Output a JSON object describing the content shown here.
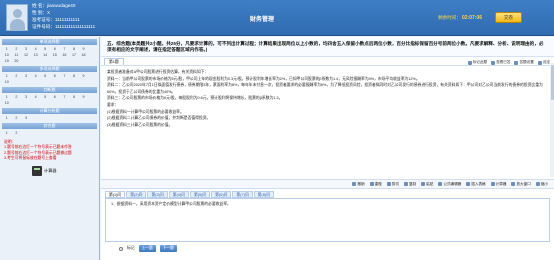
{
  "header": {
    "candidate_name_line": "姓 名：jiaowudage40",
    "candidate_gender_line": "性 别：X",
    "candidate_id_line": "准考证号：11111111111",
    "candidate_idcard_line": "证件号码：111111111111111111",
    "title": "财务管理",
    "timer_label": "剩余时间：",
    "timer_value": "02:07:06",
    "submit_label": "交卷"
  },
  "sidebar": {
    "sections": [
      {
        "title": "单项选择题",
        "numbers": [
          "1",
          "2",
          "3",
          "4",
          "5",
          "6",
          "7",
          "8",
          "9",
          "10",
          "11",
          "12",
          "13",
          "14",
          "15",
          "16",
          "17",
          "18",
          "19",
          "20"
        ]
      },
      {
        "title": "多项选择题",
        "numbers": [
          "1",
          "2",
          "3",
          "4",
          "5",
          "6",
          "7",
          "8",
          "9",
          "10"
        ]
      },
      {
        "title": "判断题",
        "numbers": [
          "1",
          "2",
          "3",
          "4",
          "5",
          "6",
          "7",
          "8",
          "9",
          "10"
        ]
      },
      {
        "title": "计算分析题",
        "numbers": [
          "1",
          "2",
          "3"
        ]
      },
      {
        "title": "综合题",
        "numbers": [
          "1",
          "2"
        ]
      }
    ],
    "notes": [
      "说明：",
      "1.题号前右边打一个符号表示已题未作答",
      "2.题号前右边打一个符号表示已题做过题",
      "3.考生可将鼠标放在题号上查看"
    ],
    "calculator_label": "计算器"
  },
  "main": {
    "question_title": "五、综合题(本类题共2小题，共25分，凡要求计算的，可不列出计算过程；计算结果出现两位以上小数的，均四舍五入保留小数点后两位小数，百分比指标保留百分号前两位小数。凡要求解释、分析、说明理由的，必须有相应的文字阐述，请在指定答题区域内作答。)",
    "question_tabs": [
      "第1题"
    ],
    "toolbar": [
      "标记此题",
      "查看已答",
      "答题设置",
      "设定"
    ],
    "body_paragraphs": [
      "某投资者准备对A甲公司股票进行投资估算，有关资料如下：",
      "资料一：当前甲公司股票的市场价格为5元/股，甲公司上年的现金股利为0.3元/股，预计股利年增长率为2%，已知甲公司股票的β系数为1.4，无风险报酬率为4%，市场平均收益率为12%。",
      "资料二：乙公司2020年7月1日拟面值发行债券，债券期限5年，票面利率为8%，每年年末付息一次，投资者要求的必要报酬率为6%，为了降低投资风险，投资者拟同时对乙公司发行的债券进行投资，有关资料如下：甲公司对乙公司当前发行的债券的投资比重为60%，投资于乙公司债券的比重为40%。",
      "资料三：乙公司股票的市场价格为6元/股，每股股利为0.6元，预计股利将保持增长，股票的β系数为1.2。",
      "要求：",
      "(1)根据资料一计算甲公司股票的必要收益率。",
      "(2)根据资料二计算乙公司债券的价值，并判断是否值得投资。",
      "(3)根据资料三计算乙公司股票的价值。"
    ],
    "answer_toolbar": [
      "撤销",
      "重做",
      "剪切",
      "复制",
      "粘贴",
      "公式编辑器",
      "插入表格",
      "计算器",
      "放大窗口",
      "缩小"
    ],
    "answer_tabs": [
      "第(1)问",
      "第(2)问",
      "第(3)问",
      "第(4)问",
      "第(5)问",
      "第(6)问",
      "第(7)问",
      "第(8)问"
    ],
    "answer_text": "1、根据资料一，采用资本资产定价模型计算甲公司股票的必要收益率。",
    "bottom": {
      "mark_label": "标记",
      "prev_label": "上一题",
      "next_label": "下一题"
    }
  }
}
